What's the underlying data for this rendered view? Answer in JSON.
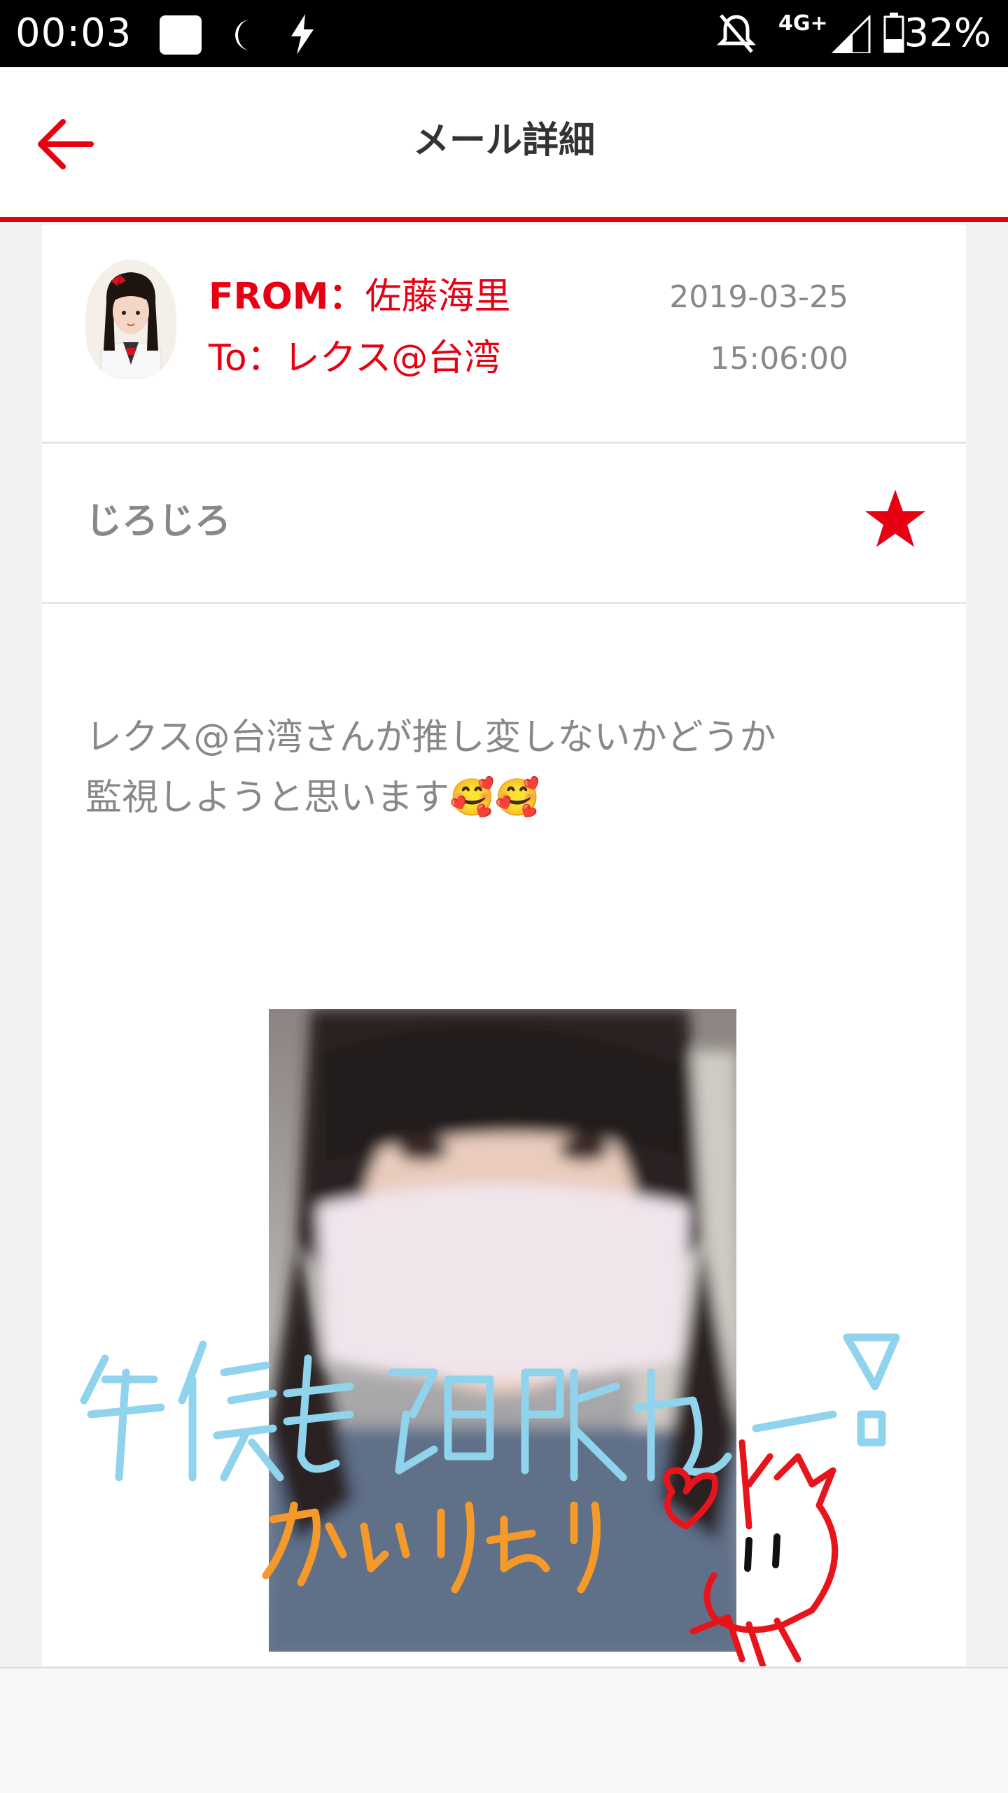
{
  "status_bar": {
    "time": "00:03",
    "network": "4G+",
    "battery": "32%"
  },
  "header": {
    "title": "メール詳細",
    "back_icon": "arrow-left-icon"
  },
  "mail": {
    "from_label": "FROM：",
    "from_name": "佐藤海里",
    "to_label": "To：",
    "to_name": "レクス@台湾",
    "date": "2019-03-25",
    "time": "15:06:00",
    "subject": "じろじろ",
    "starred": true,
    "body_line1": "レクス@台湾さんが推し変しないかどうか",
    "body_line2": "監視しようと思います🥰🥰"
  },
  "colors": {
    "accent": "#e60012",
    "muted_text": "#888888"
  }
}
